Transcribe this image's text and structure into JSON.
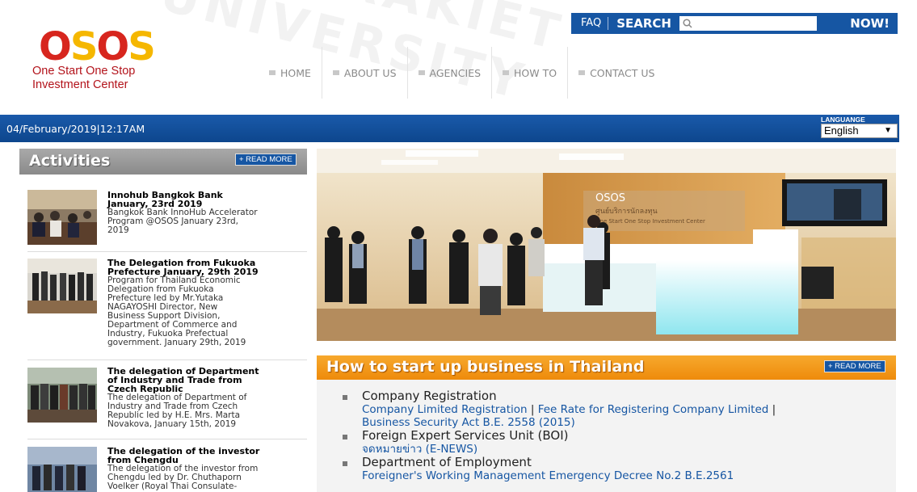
{
  "header": {
    "faq_label": "FAQ",
    "search_label": "SEARCH",
    "search_placeholder": "",
    "now_label": "NOW!"
  },
  "logo": {
    "brand": "OSOS",
    "line1": "One Start One Stop",
    "line2": "Investment Center"
  },
  "nav": {
    "items": [
      {
        "label": "HOME"
      },
      {
        "label": "ABOUT US"
      },
      {
        "label": "AGENCIES"
      },
      {
        "label": "HOW TO"
      },
      {
        "label": "CONTACT US"
      }
    ]
  },
  "datebar": {
    "datetime": "04/February/2019|12:17AM",
    "language_label": "LANGUANGE",
    "language_value": "English"
  },
  "activities": {
    "title": "Activities",
    "read_more": "+ READ MORE",
    "items": [
      {
        "title_lines": [
          "Innohub Bangkok Bank",
          "January, 23rd 2019"
        ],
        "desc_lines": [
          "Bangkok Bank InnoHub Accelerator",
          "Program @OSOS January 23rd,",
          "2019"
        ]
      },
      {
        "title_lines": [
          "The Delegation from Fukuoka",
          "Prefecture January, 29th 2019"
        ],
        "desc_lines": [
          "Program for Thailand Economic",
          "Delegation from Fukuoka",
          "Prefecture led by Mr.Yutaka",
          "NAGAYOSHI Director, New",
          "Business Support Division,",
          "Department of Commerce and",
          "Industry, Fukuoka Prefectual",
          "government. January 29th, 2019"
        ]
      },
      {
        "title_lines": [
          "The delegation of Department",
          "of Industry and Trade from",
          "Czech Republic"
        ],
        "desc_lines": [
          "The delegation of Department of",
          "Industry and Trade from Czech",
          "Republic led by H.E. Mrs. Marta",
          "Novakova, January 15th, 2019"
        ]
      },
      {
        "title_lines": [
          "The delegation of the investor",
          "from Chengdu"
        ],
        "desc_lines": [
          "The delegation of the investor from",
          "Chengdu led by Dr. Chuthaporn",
          "Voelker (Royal Thai Consulate-"
        ]
      }
    ]
  },
  "hero": {
    "sign_title": "OSOS",
    "sign_thai": "ศูนย์บริการนักลงทุน",
    "sign_sub": "One Start One Stop Investment Center"
  },
  "howto": {
    "title": "How to start up business in Thailand",
    "read_more": "+ READ MORE",
    "sections": [
      {
        "label": "Company Registration",
        "links": [
          "Company Limited Registration",
          "Fee Rate for Registering Company Limited",
          "Business Security Act B.E. 2558 (2015)"
        ]
      },
      {
        "label": "Foreign Expert Services Unit (BOI)",
        "links": [
          "จดหมายข่าว (E-NEWS)"
        ]
      },
      {
        "label": "Department of Employment",
        "links": [
          "Foreigner's Working Management Emergency Decree No.2 B.E.2561"
        ]
      }
    ]
  },
  "colors": {
    "brand_blue": "#1656a3",
    "brand_orange": "#f39a1b",
    "logo_red": "#b3131b",
    "logo_yellow": "#f5b700"
  }
}
